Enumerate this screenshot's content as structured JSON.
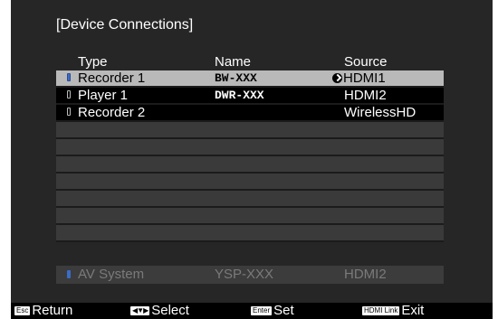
{
  "title": "[Device Connections]",
  "columns": {
    "type": "Type",
    "name": "Name",
    "source": "Source"
  },
  "rows": [
    {
      "type": "Recorder 1",
      "name": "BW-XXX",
      "source": "HDMI1",
      "selected": true,
      "linked": true
    },
    {
      "type": "Player 1",
      "name": "DWR-XXX",
      "source": "HDMI2"
    },
    {
      "type": "Recorder 2",
      "name": "",
      "source": "WirelessHD"
    }
  ],
  "empty_rows": 7,
  "av_system": {
    "type": "AV System",
    "name": "YSP-XXX",
    "source": "HDMI2"
  },
  "footer": {
    "return": {
      "key": "Esc",
      "label": "Return"
    },
    "select": {
      "key": "◀▼▶",
      "label": "Select"
    },
    "set": {
      "key": "Enter",
      "label": "Set"
    },
    "exit": {
      "key": "HDMI Link",
      "label": "Exit"
    }
  },
  "colors": {
    "panel": "#262626",
    "selected_row": "#b9b9b9",
    "icon_blue": "#3a6cc8"
  },
  "icons": {
    "device": "device-icon",
    "link": "link-icon"
  }
}
